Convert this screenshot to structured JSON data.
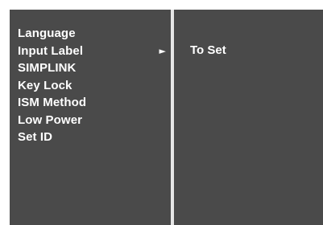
{
  "menu": {
    "items": [
      {
        "label": "Language"
      },
      {
        "label": "Input Label",
        "arrow": "►"
      },
      {
        "label": "SIMPLINK"
      },
      {
        "label": "Key Lock"
      },
      {
        "label": "ISM Method"
      },
      {
        "label": "Low Power"
      },
      {
        "label": "Set ID"
      }
    ],
    "selected_index": 1
  },
  "submenu": {
    "label": "To Set"
  },
  "icons": {
    "submenu_arrow": "right-triangle-icon"
  }
}
